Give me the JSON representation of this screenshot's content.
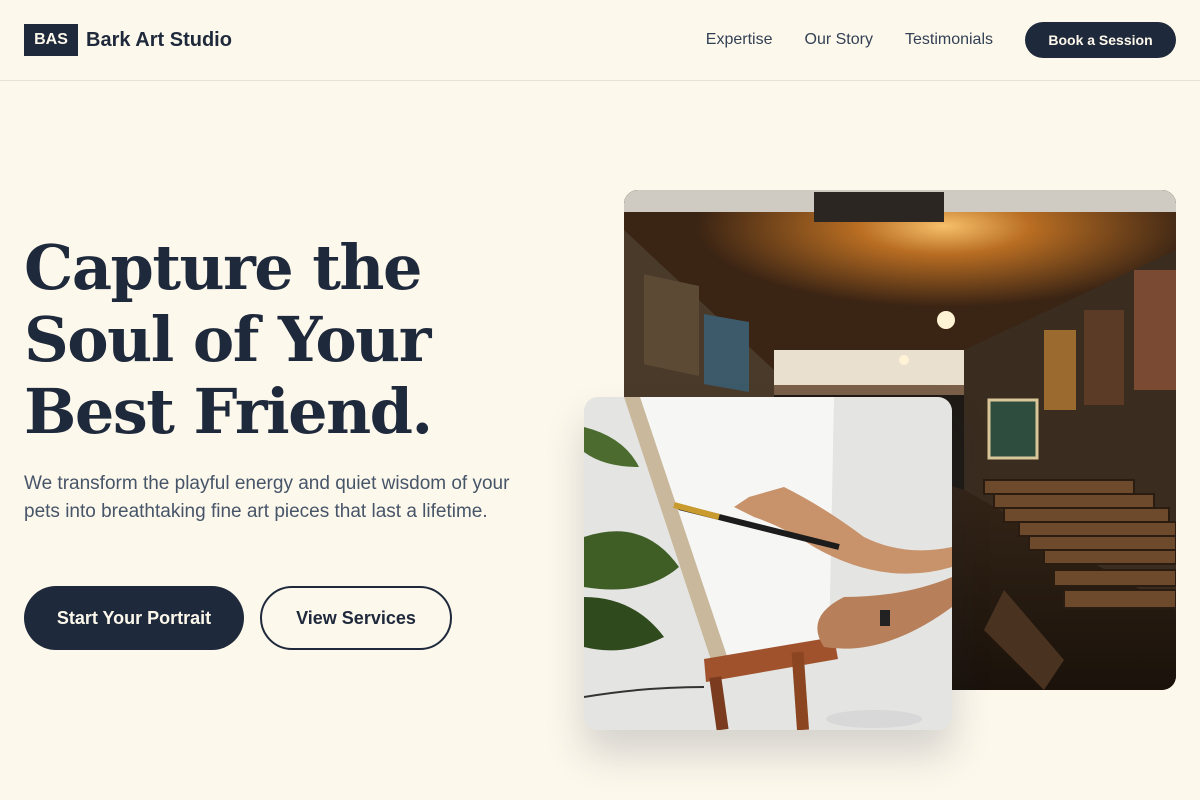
{
  "brand": {
    "logo_text": "BAS",
    "name": "Bark Art Studio"
  },
  "nav": {
    "links": [
      "Expertise",
      "Our Story",
      "Testimonials"
    ],
    "cta": "Book a Session"
  },
  "hero": {
    "title_lines": [
      "Capture the",
      "Soul of Your",
      "Best Friend."
    ],
    "subtitle": "We transform the playful energy and quiet wisdom of your pets into breathtaking fine art pieces that last a lifetime.",
    "primary_button": "Start Your Portrait",
    "secondary_button": "View Services"
  },
  "images": {
    "gallery": "photo-art-gallery-corridor",
    "painting": "photo-hand-painting-on-easel"
  },
  "colors": {
    "background": "#fdf8ec",
    "primary": "#1e293b",
    "text_muted": "#475569"
  }
}
